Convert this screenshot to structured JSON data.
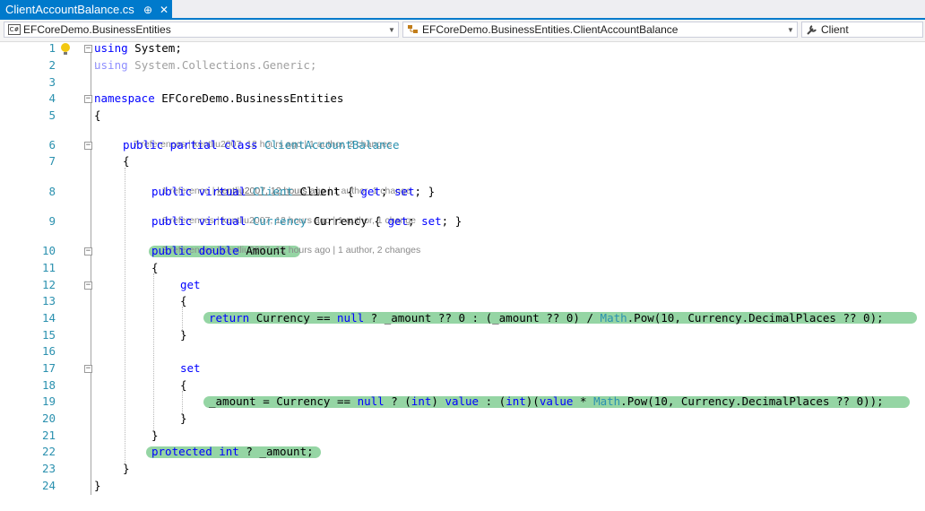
{
  "tab": {
    "title": "ClientAccountBalance.cs",
    "pin_glyph": "⊕",
    "close_glyph": "✕"
  },
  "navbar": {
    "project": "EFCoreDemo.BusinessEntities",
    "type": "EFCoreDemo.BusinessEntities.ClientAccountBalance",
    "member": "Client"
  },
  "code": {
    "lines": [
      {
        "num": "1",
        "tokens": [
          [
            "kw",
            "using"
          ],
          [
            "",
            "System;"
          ]
        ]
      },
      {
        "num": "2",
        "tokens": [
          [
            "dimkw",
            "using"
          ],
          [
            "dim",
            "System.Collections.Generic;"
          ]
        ]
      },
      {
        "num": "3",
        "tokens": []
      },
      {
        "num": "4",
        "tokens": [
          [
            "kw",
            "namespace"
          ],
          [
            "",
            "EFCoreDemo.BusinessEntities"
          ]
        ]
      },
      {
        "num": "5",
        "tokens": [
          [
            "",
            "{"
          ]
        ]
      },
      {
        "num": "6",
        "tokens": [
          [
            "kw",
            "public partial class"
          ],
          [
            "ty",
            "ClientAccountBalance"
          ]
        ]
      },
      {
        "num": "7",
        "tokens": [
          [
            "",
            "{"
          ]
        ]
      },
      {
        "num": "8",
        "tokens": [
          [
            "kw",
            "public virtual"
          ],
          [
            "ty",
            "Client"
          ],
          [
            "",
            "Client {"
          ],
          [
            "kw",
            "get"
          ],
          [
            "",
            ";"
          ],
          [
            "kw",
            "set"
          ],
          [
            "",
            "; }"
          ]
        ]
      },
      {
        "num": "9",
        "tokens": [
          [
            "kw",
            "public virtual"
          ],
          [
            "ty",
            "Currency"
          ],
          [
            "",
            "Currency {"
          ],
          [
            "kw",
            "get"
          ],
          [
            "",
            ";"
          ],
          [
            "kw",
            "set"
          ],
          [
            "",
            "; }"
          ]
        ]
      },
      {
        "num": "10",
        "tokens": [
          [
            "kw",
            "public double"
          ],
          [
            "",
            "Amount"
          ]
        ]
      },
      {
        "num": "11",
        "tokens": [
          [
            "",
            "{"
          ]
        ]
      },
      {
        "num": "12",
        "tokens": [
          [
            "kw",
            "get"
          ]
        ]
      },
      {
        "num": "13",
        "tokens": [
          [
            "",
            "{"
          ]
        ]
      },
      {
        "num": "14",
        "tokens": [
          [
            "kw",
            "return"
          ],
          [
            "",
            "Currency =="
          ],
          [
            "kw",
            "null"
          ],
          [
            "",
            "? _amount ?? 0 : (_amount ?? 0) /"
          ],
          [
            "ty",
            "Math"
          ],
          [
            "",
            ".Pow(10, Currency.DecimalPlaces ?? 0);"
          ]
        ]
      },
      {
        "num": "15",
        "tokens": [
          [
            "",
            "}"
          ]
        ]
      },
      {
        "num": "16",
        "tokens": []
      },
      {
        "num": "17",
        "tokens": [
          [
            "kw",
            "set"
          ]
        ]
      },
      {
        "num": "18",
        "tokens": [
          [
            "",
            "{"
          ]
        ]
      },
      {
        "num": "19",
        "tokens": [
          [
            "",
            "_amount = Currency =="
          ],
          [
            "kw",
            "null"
          ],
          [
            "",
            "? ("
          ],
          [
            "kw",
            "int"
          ],
          [
            "",
            ")"
          ],
          [
            "kw",
            "value"
          ],
          [
            "",
            ": ("
          ],
          [
            "kw",
            "int"
          ],
          [
            "",
            ")("
          ],
          [
            "kw",
            "value"
          ],
          [
            "",
            "*"
          ],
          [
            "ty",
            "Math"
          ],
          [
            "",
            ".Pow(10, Currency.DecimalPlaces ?? 0));"
          ]
        ]
      },
      {
        "num": "20",
        "tokens": [
          [
            "",
            "}"
          ]
        ]
      },
      {
        "num": "21",
        "tokens": [
          [
            "",
            "}"
          ]
        ]
      },
      {
        "num": "22",
        "tokens": [
          [
            "kw",
            "protected int"
          ],
          [
            "",
            "? _amount;"
          ]
        ]
      },
      {
        "num": "23",
        "tokens": [
          [
            "",
            "}"
          ]
        ]
      },
      {
        "num": "24",
        "tokens": [
          [
            "",
            "}"
          ]
        ]
      }
    ],
    "lens": {
      "class": {
        "refs": "7 references",
        "author_time": "kentliu2007, 12 hours ago",
        "changes": "1 author, 2 changes"
      },
      "client": {
        "refs": "1 reference",
        "author_time": "kentliu2007, 12 hours ago",
        "changes": "1 author, 1 change"
      },
      "currency": {
        "refs": "6 references",
        "author_time": "kentliu2007, 12 hours ago",
        "changes": "1 author, 1 change"
      },
      "amount": {
        "refs": "3 references",
        "author_time": "kentliu2007, 12 hours ago",
        "changes": "1 author, 2 changes"
      }
    }
  },
  "colors": {
    "accent": "#007acc",
    "keyword": "#0000ff",
    "type": "#2b91af",
    "line_number": "#2b91af",
    "highlight": "#95d5a4"
  }
}
